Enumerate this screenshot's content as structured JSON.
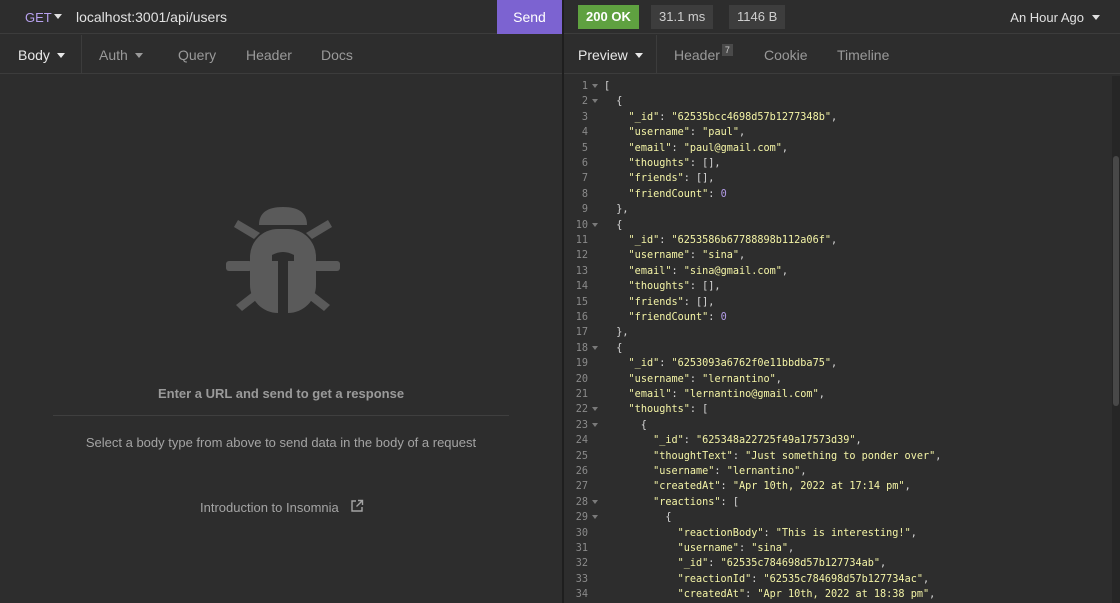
{
  "request": {
    "method": "GET",
    "url": "localhost:3001/api/users",
    "send_label": "Send",
    "tabs": [
      {
        "label": "Body"
      },
      {
        "label": "Auth"
      },
      {
        "label": "Query"
      },
      {
        "label": "Header"
      },
      {
        "label": "Docs"
      }
    ],
    "empty_title": "Enter a URL and send to get a response",
    "empty_sub": "Select a body type from above to send data in the body of a request",
    "intro_link": "Introduction to Insomnia"
  },
  "response": {
    "status_code": "200",
    "status_text": "OK",
    "time": "31.1 ms",
    "size": "1146 B",
    "time_ago": "An Hour Ago",
    "tabs": [
      {
        "label": "Preview"
      },
      {
        "label": "Header",
        "badge": "7"
      },
      {
        "label": "Cookie"
      },
      {
        "label": "Timeline"
      }
    ]
  },
  "code_lines": [
    {
      "n": 1,
      "fold": true,
      "t": "["
    },
    {
      "n": 2,
      "fold": true,
      "t": "  {"
    },
    {
      "n": 3,
      "t": "    \"_id\": \"62535bcc4698d57b1277348b\","
    },
    {
      "n": 4,
      "t": "    \"username\": \"paul\","
    },
    {
      "n": 5,
      "t": "    \"email\": \"paul@gmail.com\","
    },
    {
      "n": 6,
      "t": "    \"thoughts\": [],"
    },
    {
      "n": 7,
      "t": "    \"friends\": [],"
    },
    {
      "n": 8,
      "t": "    \"friendCount\": 0"
    },
    {
      "n": 9,
      "t": "  },"
    },
    {
      "n": 10,
      "fold": true,
      "t": "  {"
    },
    {
      "n": 11,
      "t": "    \"_id\": \"6253586b67788898b112a06f\","
    },
    {
      "n": 12,
      "t": "    \"username\": \"sina\","
    },
    {
      "n": 13,
      "t": "    \"email\": \"sina@gmail.com\","
    },
    {
      "n": 14,
      "t": "    \"thoughts\": [],"
    },
    {
      "n": 15,
      "t": "    \"friends\": [],"
    },
    {
      "n": 16,
      "t": "    \"friendCount\": 0"
    },
    {
      "n": 17,
      "t": "  },"
    },
    {
      "n": 18,
      "fold": true,
      "t": "  {"
    },
    {
      "n": 19,
      "t": "    \"_id\": \"6253093a6762f0e11bbdba75\","
    },
    {
      "n": 20,
      "t": "    \"username\": \"lernantino\","
    },
    {
      "n": 21,
      "t": "    \"email\": \"lernantino@gmail.com\","
    },
    {
      "n": 22,
      "fold": true,
      "t": "    \"thoughts\": ["
    },
    {
      "n": 23,
      "fold": true,
      "t": "      {"
    },
    {
      "n": 24,
      "t": "        \"_id\": \"625348a22725f49a17573d39\","
    },
    {
      "n": 25,
      "t": "        \"thoughtText\": \"Just something to ponder over\","
    },
    {
      "n": 26,
      "t": "        \"username\": \"lernantino\","
    },
    {
      "n": 27,
      "t": "        \"createdAt\": \"Apr 10th, 2022 at 17:14 pm\","
    },
    {
      "n": 28,
      "fold": true,
      "t": "        \"reactions\": ["
    },
    {
      "n": 29,
      "fold": true,
      "t": "          {"
    },
    {
      "n": 30,
      "t": "            \"reactionBody\": \"This is interesting!\","
    },
    {
      "n": 31,
      "t": "            \"username\": \"sina\","
    },
    {
      "n": 32,
      "t": "            \"_id\": \"62535c784698d57b127734ab\","
    },
    {
      "n": 33,
      "t": "            \"reactionId\": \"62535c784698d57b127734ac\","
    },
    {
      "n": 34,
      "t": "            \"createdAt\": \"Apr 10th, 2022 at 18:38 pm\","
    }
  ],
  "colors": {
    "accent": "#7c63d1",
    "status_ok": "#5fa140",
    "method": "#b7a1ee",
    "string": "#f4f4a6",
    "number": "#b39ce8"
  }
}
